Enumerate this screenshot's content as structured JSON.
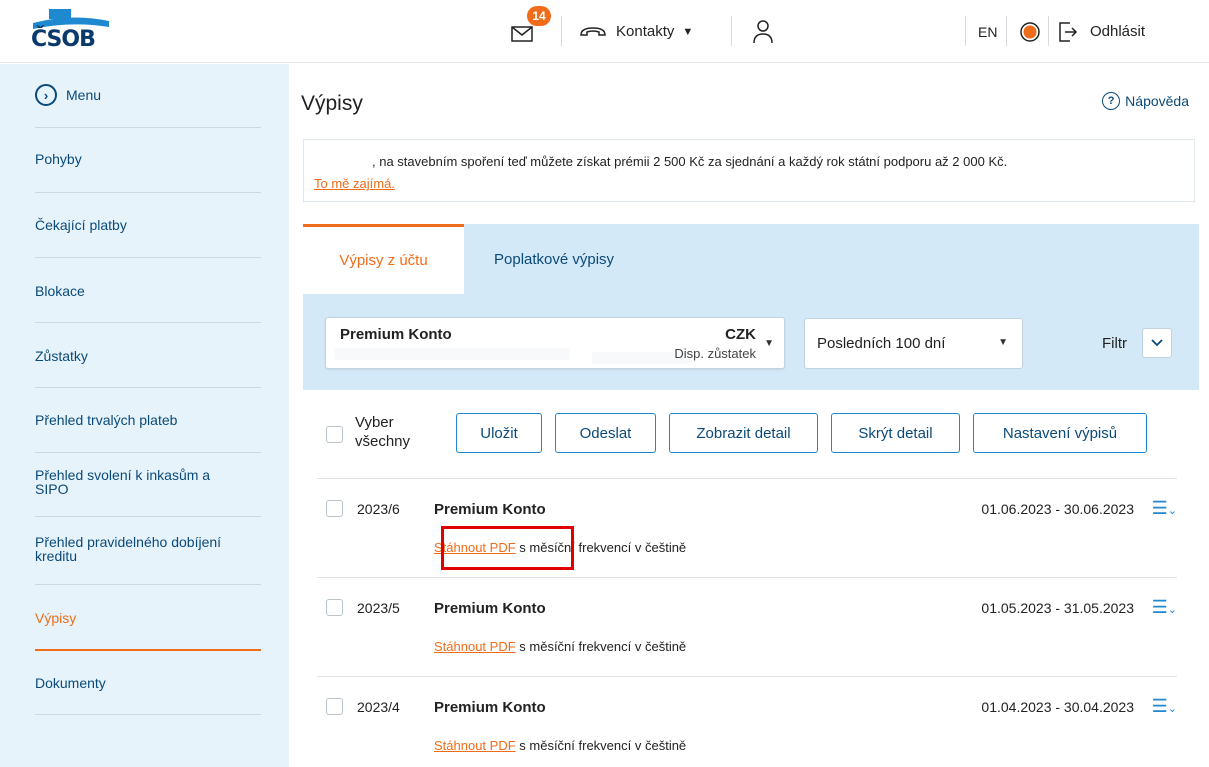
{
  "header": {
    "logo": "ČSOB",
    "mail_badge": "14",
    "contacts_label": "Kontakty",
    "language": "EN",
    "logout_label": "Odhlásit"
  },
  "sidebar": {
    "menu_label": "Menu",
    "items": [
      {
        "label": "Pohyby"
      },
      {
        "label": "Čekající platby"
      },
      {
        "label": "Blokace"
      },
      {
        "label": "Zůstatky"
      },
      {
        "label": "Přehled trvalých plateb"
      },
      {
        "label": "Přehled svolení k inkasům a SIPO"
      },
      {
        "label": "Přehled pravidelného dobíjení kreditu"
      },
      {
        "label": "Výpisy"
      },
      {
        "label": "Dokumenty"
      }
    ]
  },
  "main": {
    "title": "Výpisy",
    "help_label": "Nápověda",
    "promo_text": ", na stavebním spoření teď můžete získat prémii 2 500 Kč za sjednání a každý rok státní podporu až 2 000 Kč.",
    "promo_link": "To mě zajímá.",
    "tabs": [
      {
        "label": "Výpisy z účtu"
      },
      {
        "label": "Poplatkové výpisy"
      }
    ],
    "account": {
      "name": "Premium Konto",
      "currency": "CZK",
      "sub_label": "Disp. zůstatek"
    },
    "period_value": "Posledních 100 dní",
    "filter_label": "Filtr",
    "select_all_label": "Vyber všechny",
    "buttons": [
      "Uložit",
      "Odeslat",
      "Zobrazit detail",
      "Skrýt detail",
      "Nastavení výpisů"
    ],
    "statements": [
      {
        "period": "2023/6",
        "title": "Premium Konto",
        "dates": "01.06.2023 - 30.06.2023",
        "link": "Stáhnout PDF",
        "desc": " s měsíční frekvencí v češtině"
      },
      {
        "period": "2023/5",
        "title": "Premium Konto",
        "dates": "01.05.2023 - 31.05.2023",
        "link": "Stáhnout PDF",
        "desc": " s měsíční frekvencí v češtině"
      },
      {
        "period": "2023/4",
        "title": "Premium Konto",
        "dates": "01.04.2023 - 30.04.2023",
        "link": "Stáhnout PDF",
        "desc": " s měsíční frekvencí v češtině"
      }
    ]
  },
  "colors": {
    "accent": "#ef6c1a",
    "brand_blue": "#0a4a7a",
    "sidebar_bg": "#e7f3fb",
    "highlight": "#e00000"
  }
}
